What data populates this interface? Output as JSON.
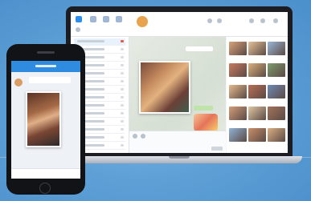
{
  "scene": {
    "background_color": "#5ea0d6",
    "accent": "#2b8ee8",
    "devices": [
      "laptop",
      "phone"
    ]
  },
  "laptop_app": {
    "toolbar_icons": [
      "chat-icon",
      "contacts-icon",
      "user-icon",
      "settings-icon",
      "folder-icon"
    ],
    "contact_count": 14,
    "gallery_thumb_colors": [
      "#d8a27a",
      "#e6c29a",
      "#9bb7d9",
      "#c97a5d",
      "#d9b07b",
      "#7e9c6e",
      "#e5b98c",
      "#b86f56",
      "#6f8ab5",
      "#d49d7a",
      "#e1c7a4",
      "#a2725b",
      "#8fb3d6",
      "#c98f69",
      "#dcae82"
    ]
  },
  "phone_app": {
    "header_color": "#2e8be0"
  }
}
